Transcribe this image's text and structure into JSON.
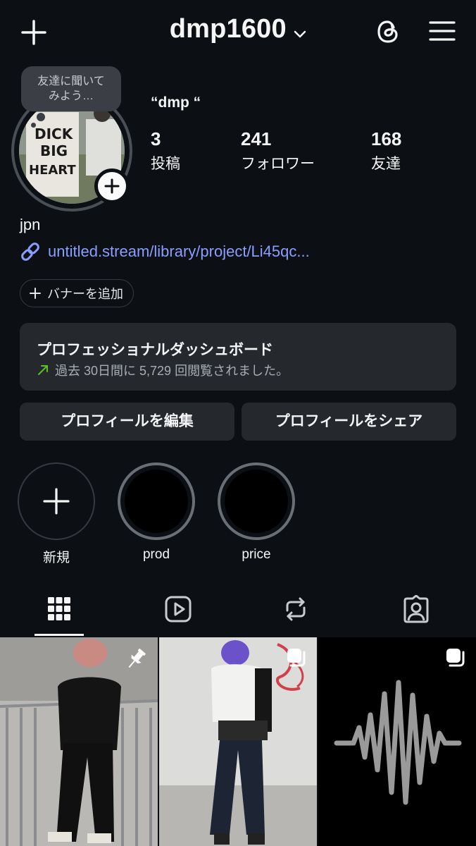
{
  "header": {
    "username": "dmp1600",
    "icons": [
      "plus-icon",
      "chevron-down-icon",
      "threads-icon",
      "hamburger-menu-icon"
    ]
  },
  "profile": {
    "note_text_line1": "友達に聞いて",
    "note_text_line2": "みよう…",
    "display_name": "“dmp “",
    "stats": [
      {
        "value": "3",
        "label": "投稿"
      },
      {
        "value": "241",
        "label": "フォロワー"
      },
      {
        "value": "168",
        "label": "友達"
      }
    ],
    "bio": "jpn",
    "link": "untitled.stream/library/project/Li45qc...",
    "add_banner": "バナーを追加"
  },
  "dashboard": {
    "title": "プロフェッショナルダッシュボード",
    "subtitle": "過去 30日間に 5,729 回閲覧されました。"
  },
  "actions": {
    "edit_profile": "プロフィールを編集",
    "share_profile": "プロフィールをシェア"
  },
  "highlights": [
    {
      "label": "新規"
    },
    {
      "label": "prod"
    },
    {
      "label": "price"
    }
  ],
  "tabs": [
    "grid-icon",
    "reels-icon",
    "reposts-icon",
    "tagged-icon"
  ],
  "posts": [
    {
      "badge": "pin-icon"
    },
    {
      "badge": "multiple-posts-icon"
    },
    {
      "badge": "multiple-posts-icon"
    }
  ],
  "colors": {
    "background": "#0c1014",
    "card": "#25292e",
    "link": "#8a9eff",
    "text": "#f5f5f5",
    "trend": "#58c322"
  }
}
